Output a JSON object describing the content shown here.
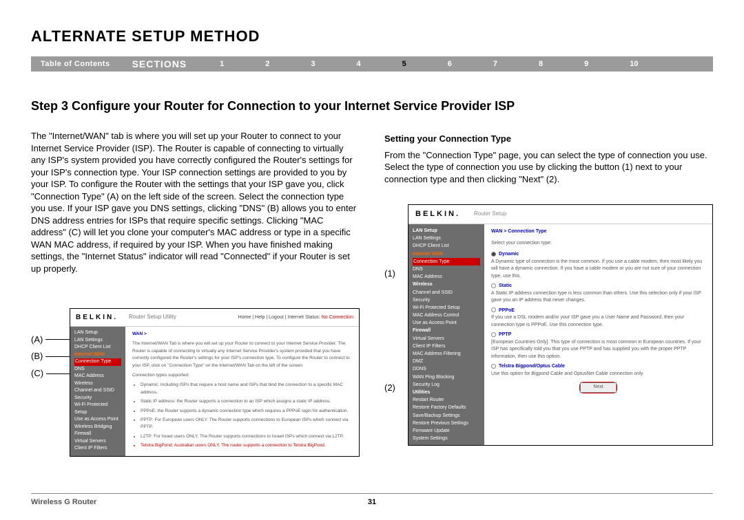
{
  "page_title": "ALTERNATE SETUP METHOD",
  "nav": {
    "toc": "Table of Contents",
    "sections": "SECTIONS",
    "nums": [
      "1",
      "2",
      "3",
      "4",
      "5",
      "6",
      "7",
      "8",
      "9",
      "10"
    ],
    "current": "5"
  },
  "step_heading": "Step 3 Configure your Router for Connection to your Internet Service Provider ISP",
  "left_para": "The \"Internet/WAN\" tab is where you will set up your Router to connect to your Internet Service Provider (ISP). The Router is capable of connecting to virtually any ISP's system provided you have correctly configured the Router's settings for your ISP's connection type. Your ISP connection settings are provided to you by your ISP. To configure the Router with the settings that your ISP gave you, click \"Connection Type\" (A) on the left side of the screen. Select the connection type you use. If your ISP gave you DNS settings, clicking \"DNS\" (B) allows you to enter DNS address entries for ISPs that require specific settings. Clicking \"MAC address\" (C) will let you clone your computer's MAC address or type in a specific WAN MAC address, if required by your ISP. When you have finished making settings, the \"Internet Status\" indicator will read \"Connected\" if your Router is set up properly.",
  "right_head": "Setting your Connection Type",
  "right_para": "From the \"Connection Type\" page, you can select the type of connection you use. Select the type of connection you use by clicking the button (1) next to your connection type and then clicking \"Next\" (2).",
  "labels": {
    "a": "(A)",
    "b": "(B)",
    "c": "(C)"
  },
  "ss1": {
    "brand": "BELKIN.",
    "util": "Router Setup Utility",
    "links": "Home | Help | Logout | Internet Status:",
    "status": "No Connection",
    "side": [
      "LAN Setup",
      "LAN Settings",
      "DHCP Client List",
      "Internet WAN",
      "Connection Type",
      "DNS",
      "MAC Address",
      "Wireless",
      "Channel and SSID",
      "Security",
      "Wi-Fi Protected Setup",
      "Use as Access Point",
      "Wireless Bridging",
      "Firewall",
      "Virtual Servers",
      "Client IP Filters"
    ],
    "wan": "WAN >",
    "intro": "The Internet/WAN Tab is where you will set up your Router to connect to your Internet Service Provider. The Router is capable of connecting to virtually any Internet Service Provider's system provided that you have correctly configured the Router's settings for your ISP's connection type. To configure the Router to connect to your ISP, click on \"Connection Type\" on the Internet/WAN Tab on the left of the screen.",
    "supported": "Connection types supported:",
    "bullets": [
      "Dynamic: Including ISPs that require a host name and ISPs that bind the connection to a specific MAC address.",
      "Static IP address: the Router supports a connection to an ISP which assigns a static IP address.",
      "PPPoE: the Router supports a dynamic connection type which requires a PPPoE login for authentication.",
      "PPTP: For European users ONLY. The Router supports connections to European ISPs which connect via PPTP.",
      "L2TP: For Israel users ONLY. The Router supports connections to Israeli ISPs which connect via L2TP.",
      "Telstra BigPond: Australian users ONLY. The router supports a connection to Telstra BigPond."
    ]
  },
  "ss2": {
    "brand": "BELKIN.",
    "rs": "Router Setup",
    "side": [
      "LAN Setup",
      "LAN Settings",
      "DHCP Client List",
      "Internet WAN",
      "Connection Type",
      "DNS",
      "MAC Address",
      "Wireless",
      "Channel and SSID",
      "Security",
      "Wi-Fi Protected Setup",
      "MAC Address Control",
      "Use as Access Point",
      "Firewall",
      "Virtual Servers",
      "Client IP Filters",
      "MAC Address Filtering",
      "DMZ",
      "DDNS",
      "WAN Ping Blocking",
      "Security Log",
      "Utilities",
      "Restart Router",
      "Restore Factory Defaults",
      "Save/Backup Settings",
      "Restore Previous Settings",
      "Firmware Update",
      "System Settings"
    ],
    "bc": "WAN > Connection Type",
    "prompt": "Select your connection type:",
    "opts": [
      {
        "name": "Dynamic",
        "desc": "A Dynamic type of connection is the most common. If you use a cable modem, then most likely you will have a dynamic connection. If you have a cable modem or you are not sure of your connection type, use this."
      },
      {
        "name": "Static",
        "desc": "A Static IP address connection type is less common than others. Use this selection only if your ISP gave you an IP address that never changes."
      },
      {
        "name": "PPPoE",
        "desc": "If you use a DSL modem and/or your ISP gave you a User Name and Password, then your connection type is PPPoE. Use this connection type."
      },
      {
        "name": "PPTP",
        "desc": "[European Countries Only]. This type of connection is most common in European countries. If your ISP has specifically told you that you use PPTP and has supplied you with the proper PPTP information, then use this option."
      },
      {
        "name": "Telstra Bigpond/Optus Cable",
        "desc": "Use this option for Bigpond Cable and OptusNet Cable connection only."
      }
    ],
    "next": "Next"
  },
  "callouts": {
    "one": "(1)",
    "two": "(2)"
  },
  "footer": {
    "prod": "Wireless G Router",
    "page": "31"
  }
}
